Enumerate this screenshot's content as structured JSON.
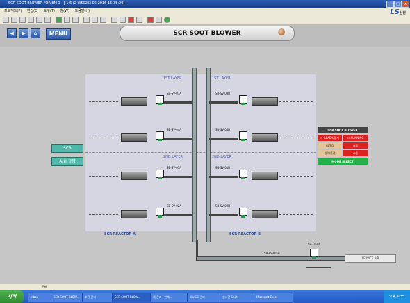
{
  "window": {
    "title": "SCR SOOT BLOWER FOR EM 1 - [ 1.6 (2 W5025) 05.2016 15:35:20]"
  },
  "menubar": {
    "items": [
      "프로젝트(P)",
      "편집(E)",
      "도구(T)",
      "창(W)",
      "도움말(H)"
    ]
  },
  "brand": {
    "logo": "LS",
    "sub": "산전"
  },
  "header": {
    "title": "SCR SOOT BLOWER",
    "menu_label": "MENU"
  },
  "nav": {
    "back": "◀",
    "forward": "▶",
    "home": "⌂"
  },
  "layers": {
    "first": "1ST LAYER",
    "second": "2ND LAYER"
  },
  "blowers": {
    "r1": {
      "a": "SB-SV-03A",
      "b": "SB-SV-03B"
    },
    "r2": {
      "a": "SB-SV-04A",
      "b": "SB-SV-04B"
    },
    "r3": {
      "a": "SB-SV-01A",
      "b": "SB-SV-01B"
    },
    "r4": {
      "a": "SB-SV-02A",
      "b": "SB-SV-02B"
    }
  },
  "reactors": {
    "a": "SCR REACTOR-A",
    "b": "SCR REACTOR-B"
  },
  "side_buttons": {
    "scr": "SCR",
    "ah": "A/H 장탐"
  },
  "soot_panel": {
    "title": "SCR SOOT BLOWER",
    "left1": "ㅁ READY/정지",
    "right1": "ㅁ RUNNING",
    "auto": "AUTO",
    "auto_state": "자동",
    "manual": "원격/운전",
    "manual_state": "수동",
    "select": "MODE SELECT",
    "colors": {
      "red": "#e02020",
      "green": "#22b04a",
      "tan": "#e6c49a"
    }
  },
  "valve": {
    "tag": "SB-FV-01",
    "line": "SB-PS-01    H"
  },
  "service": {
    "label": "SERVICE AIR"
  },
  "statusbar": {
    "text": "준비"
  },
  "taskbar": {
    "start": "시작",
    "tasks": [
      "Inbox",
      "SCR SOOT BLOW...",
      "추진 관리",
      "SCR SOOT BLOW...",
      "제 관리 - 연계...",
      "WinCC 관리",
      "실시간 모니터",
      "Microsoft Excel"
    ],
    "clock": "오후 4:35"
  }
}
